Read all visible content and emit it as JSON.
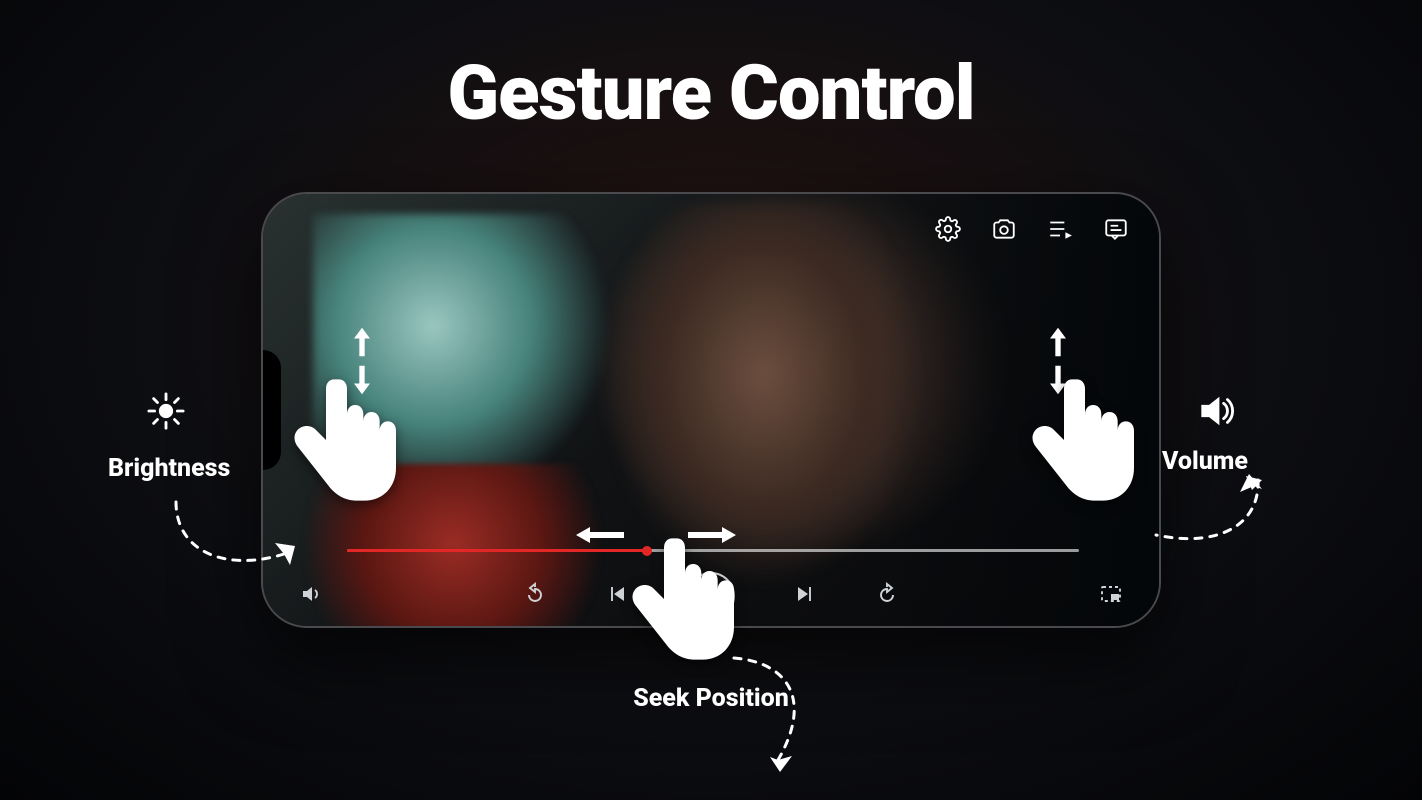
{
  "title": "Gesture Control",
  "labels": {
    "brightness": "Brightness",
    "volume": "Volume",
    "seek": "Seek Position"
  },
  "icons": {
    "brightness": "sun-icon",
    "volume": "speaker-icon",
    "settings": "gear-icon",
    "camera": "camera-icon",
    "queue": "playlist-play-icon",
    "caption": "caption-icon",
    "sound": "speaker-small-icon",
    "rewind": "rewind-10-icon",
    "prev": "skip-previous-icon",
    "play": "play-icon",
    "next": "skip-next-icon",
    "forward": "forward-10-icon",
    "pip": "pip-icon"
  },
  "player": {
    "progress_percent": 41
  }
}
